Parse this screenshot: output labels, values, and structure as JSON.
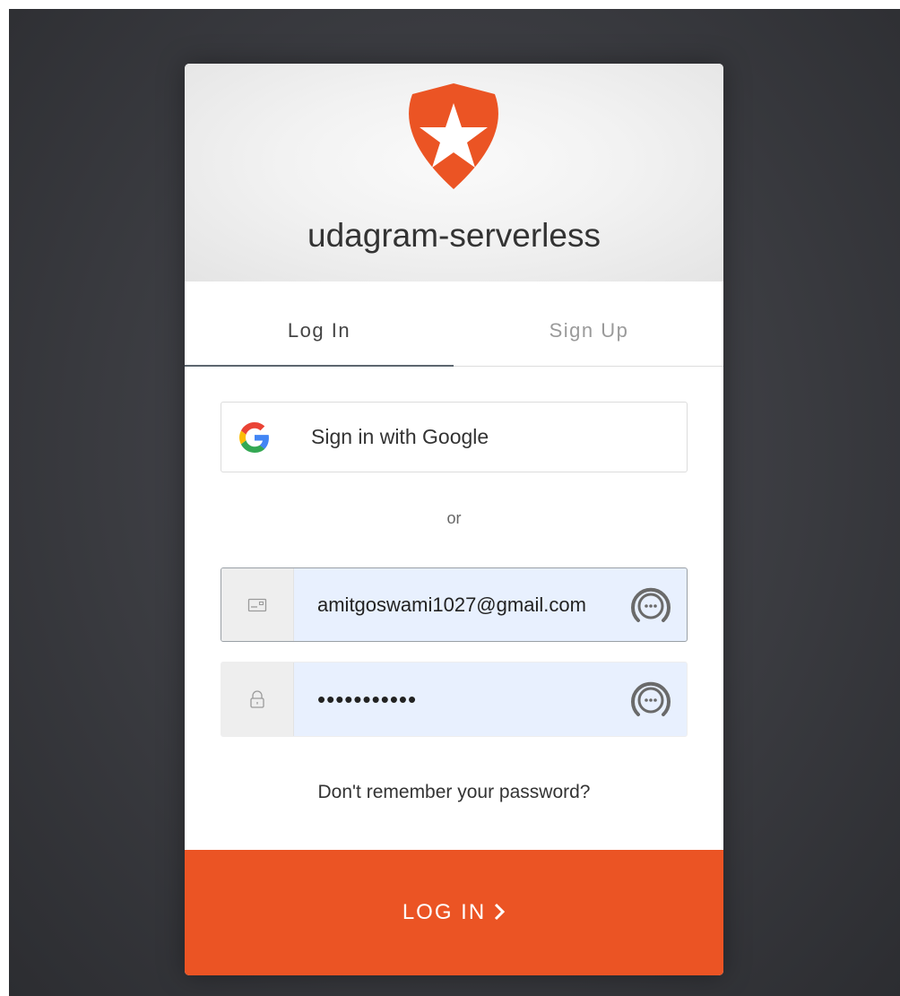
{
  "app": {
    "title": "udagram-serverless",
    "brand_color": "#eb5424"
  },
  "tabs": [
    {
      "label": "Log In",
      "active": true
    },
    {
      "label": "Sign Up",
      "active": false
    }
  ],
  "social": {
    "google_label": "Sign in with Google",
    "icon": "google-icon"
  },
  "divider": {
    "or_label": "or"
  },
  "form": {
    "email": {
      "value": "amitgoswami1027@gmail.com",
      "icon": "envelope-icon"
    },
    "password": {
      "value": "•••••••••••",
      "icon": "lock-icon"
    },
    "password_manager_icon": "password-manager-icon"
  },
  "forgot_password_label": "Don't remember your password?",
  "submit": {
    "label": "LOG IN",
    "icon": "chevron-right-icon"
  }
}
